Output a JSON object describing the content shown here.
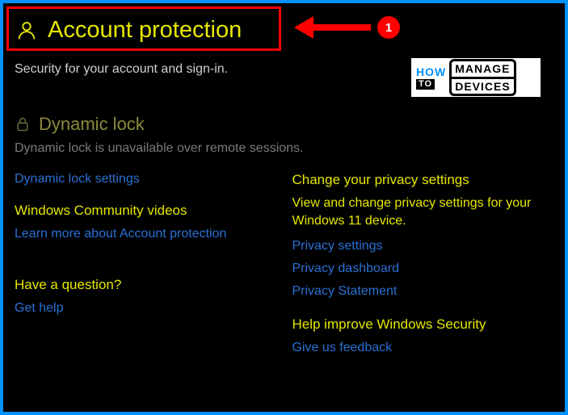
{
  "annotation": {
    "badge": "1"
  },
  "header": {
    "title": "Account protection",
    "subtitle": "Security for your account and sign-in."
  },
  "logo": {
    "how": "HOW",
    "to": "TO",
    "manage": "MANAGE",
    "devices": "DEVICES"
  },
  "dynamic_lock": {
    "title": "Dynamic lock",
    "desc": "Dynamic lock is unavailable over remote sessions.",
    "link": "Dynamic lock settings"
  },
  "left": {
    "community_heading": "Windows Community videos",
    "community_link": "Learn more about Account protection",
    "question_heading": "Have a question?",
    "help_link": "Get help"
  },
  "right": {
    "privacy_heading": "Change your privacy settings",
    "privacy_desc": "View and change privacy settings for your Windows 11 device.",
    "links": {
      "settings": "Privacy settings",
      "dashboard": "Privacy dashboard",
      "statement": "Privacy Statement"
    },
    "improve_heading": "Help improve Windows Security",
    "feedback_link": "Give us feedback"
  }
}
